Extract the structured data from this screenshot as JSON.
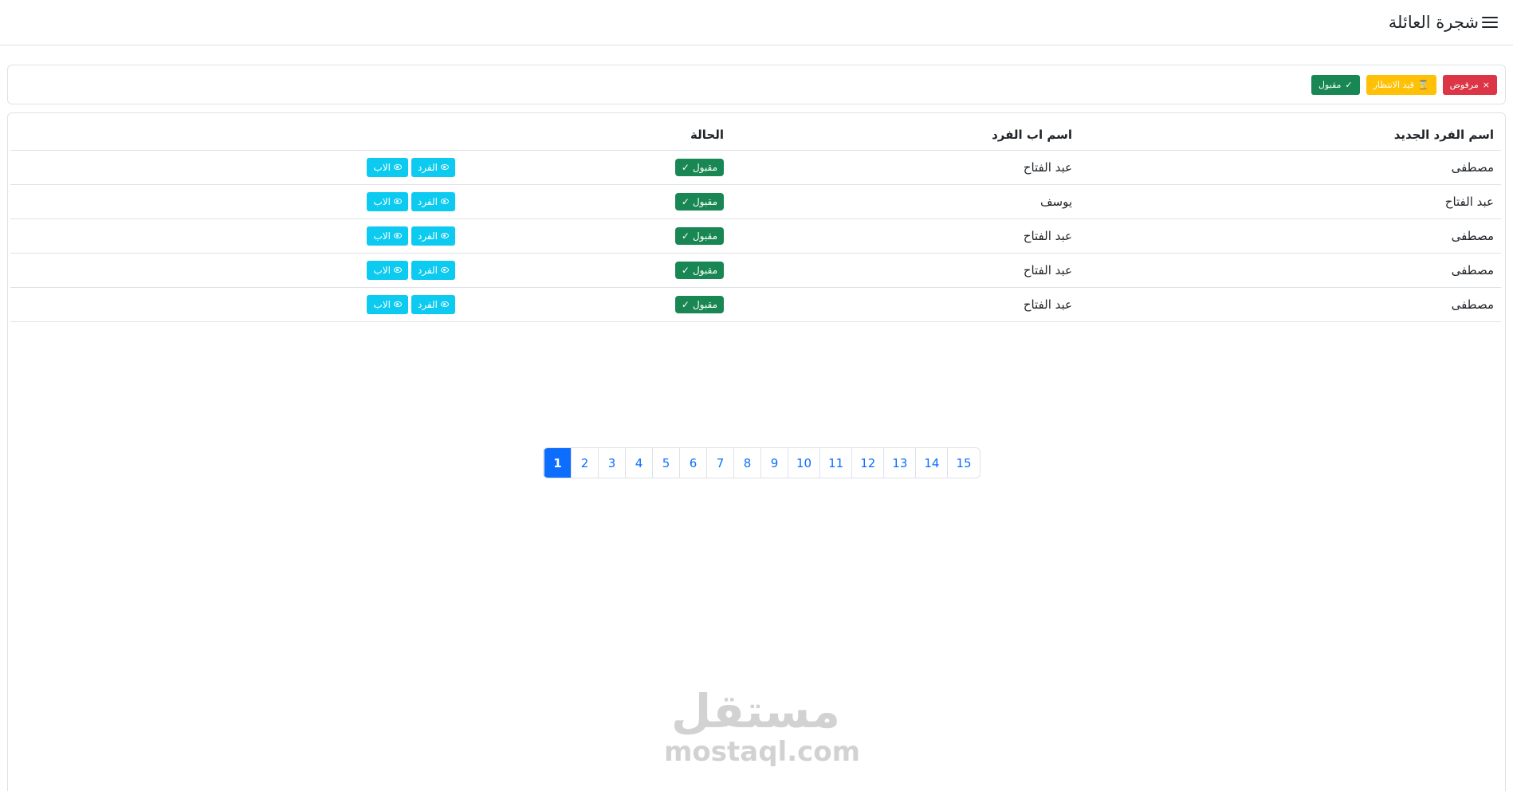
{
  "header": {
    "title": "شجرة العائلة",
    "menu_icon": "hamburger-menu-icon"
  },
  "filters": [
    {
      "label": "مرفوض",
      "icon": "×",
      "color": "#dc3545"
    },
    {
      "label": "قيد الانتظار",
      "icon": "⌛",
      "color": "#ffc107"
    },
    {
      "label": "مقبول",
      "icon": "✓",
      "color": "#198754"
    }
  ],
  "table": {
    "headers": [
      "اسم الفرد الجديد",
      "اسم اب الفرد",
      "الحالة",
      ""
    ],
    "rows": [
      {
        "name": "مصطفى",
        "father": "عبد الفتاح",
        "status": "مقبول",
        "view_member": "الفرد",
        "view_father": "الاب"
      },
      {
        "name": "عبد الفتاح",
        "father": "يوسف",
        "status": "مقبول",
        "view_member": "الفرد",
        "view_father": "الاب"
      },
      {
        "name": "مصطفى",
        "father": "عبد الفتاح",
        "status": "مقبول",
        "view_member": "الفرد",
        "view_father": "الاب"
      },
      {
        "name": "مصطفى",
        "father": "عبد الفتاح",
        "status": "مقبول",
        "view_member": "الفرد",
        "view_father": "الاب"
      },
      {
        "name": "مصطفى",
        "father": "عبد الفتاح",
        "status": "مقبول",
        "view_member": "الفرد",
        "view_father": "الاب"
      }
    ]
  },
  "pagination": {
    "pages": [
      "1",
      "2",
      "3",
      "4",
      "5",
      "6",
      "7",
      "8",
      "9",
      "10",
      "11",
      "12",
      "13",
      "14",
      "15"
    ],
    "active": "1"
  },
  "watermark": {
    "arabic": "مستقل",
    "latin": "mostaql.com"
  },
  "colors": {
    "primary": "#0d6efd",
    "success": "#198754",
    "info": "#0dcaf0",
    "danger": "#dc3545",
    "warning": "#ffc107"
  }
}
